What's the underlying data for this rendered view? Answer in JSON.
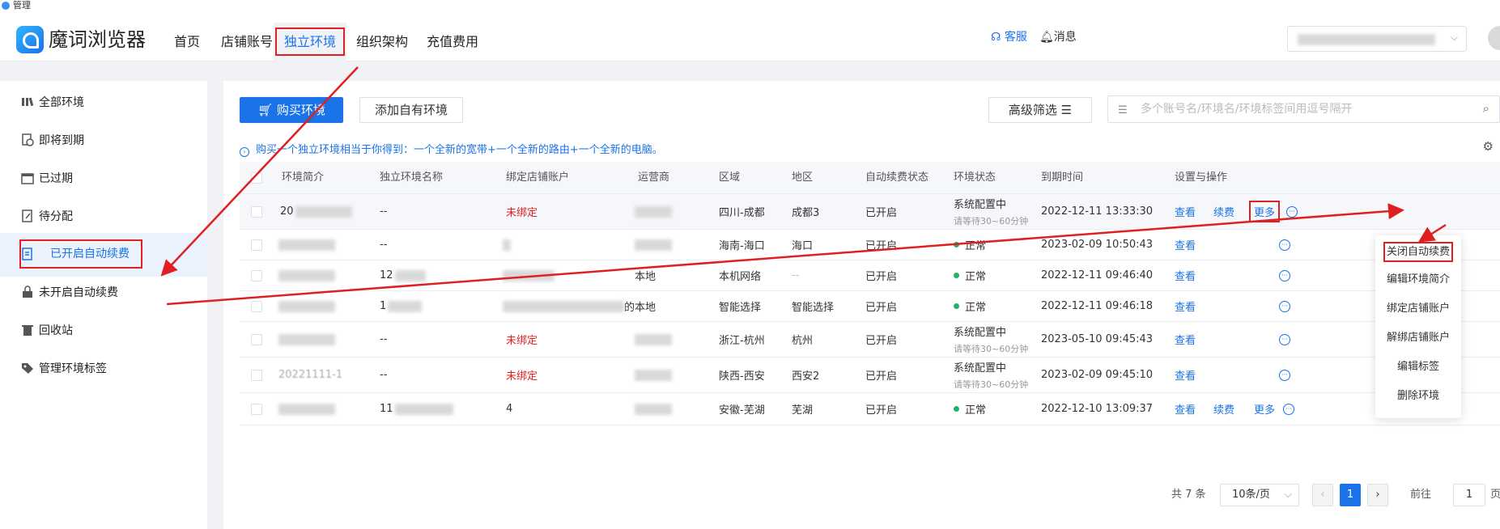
{
  "window": {
    "title": "管理"
  },
  "brand": {
    "name": "魔词浏览器"
  },
  "nav": {
    "tabs": [
      {
        "label": "首页"
      },
      {
        "label": "店铺账号"
      },
      {
        "label": "独立环境"
      },
      {
        "label": "组织架构"
      },
      {
        "label": "充值费用"
      }
    ],
    "service": "客服",
    "messages": "消息"
  },
  "sidebar": {
    "items": [
      {
        "label": "全部环境",
        "icon": "bars-icon"
      },
      {
        "label": "即将到期",
        "icon": "clock-doc-icon"
      },
      {
        "label": "已过期",
        "icon": "calendar-icon"
      },
      {
        "label": "待分配",
        "icon": "edit-doc-icon"
      },
      {
        "label": "已开启自动续费",
        "icon": "renew-doc-icon"
      },
      {
        "label": "未开启自动续费",
        "icon": "lock-icon"
      },
      {
        "label": "回收站",
        "icon": "trash-icon"
      },
      {
        "label": "管理环境标签",
        "icon": "tag-icon"
      }
    ]
  },
  "toolbar": {
    "buy_label": "购买环境",
    "add_label": "添加自有环境",
    "filter_label": "高级筛选",
    "search_placeholder": "多个账号名/环境名/环境标签间用逗号隔开"
  },
  "notice": "购买一个独立环境相当于你得到：一个全新的宽带+一个全新的路由+一个全新的电脑。",
  "table": {
    "columns": [
      "环境简介",
      "独立环境名称",
      "绑定店铺账户",
      "运营商",
      "区域",
      "地区",
      "自动续费状态",
      "环境状态",
      "到期时间",
      "设置与操作"
    ],
    "rows": [
      {
        "intro": "20",
        "name": "--",
        "account": "未绑定",
        "isp": "",
        "region": "四川-成都",
        "area": "成都3",
        "auto": "已开启",
        "status": "系统配置中",
        "status_sub": "请等待30~60分钟",
        "expire": "2022-12-11 13:33:30"
      },
      {
        "intro": "",
        "name": "--",
        "account": "",
        "isp": "",
        "region": "海南-海口",
        "area": "海口",
        "auto": "已开启",
        "status": "正常",
        "status_sub": "",
        "expire": "2023-02-09 10:50:43"
      },
      {
        "intro": "",
        "name": "12",
        "account": "",
        "isp": "本地",
        "region": "本机网络",
        "area": "--",
        "auto": "已开启",
        "status": "正常",
        "status_sub": "",
        "expire": "2022-12-11 09:46:40"
      },
      {
        "intro": "",
        "name": "1",
        "account": "的",
        "isp": "本地",
        "region": "智能选择",
        "area": "智能选择",
        "auto": "已开启",
        "status": "正常",
        "status_sub": "",
        "expire": "2022-12-11 09:46:18"
      },
      {
        "intro": "",
        "name": "--",
        "account": "未绑定",
        "isp": "",
        "region": "浙江-杭州",
        "area": "杭州",
        "auto": "已开启",
        "status": "系统配置中",
        "status_sub": "请等待30~60分钟",
        "expire": "2023-05-10 09:45:43"
      },
      {
        "intro": "20221111-1",
        "name": "--",
        "account": "未绑定",
        "isp": "",
        "region": "陕西-西安",
        "area": "西安2",
        "auto": "已开启",
        "status": "系统配置中",
        "status_sub": "请等待30~60分钟",
        "expire": "2023-02-09 09:45:10"
      },
      {
        "intro": "",
        "name": "11",
        "account": "4",
        "isp": "",
        "region": "安徽-芜湖",
        "area": "芜湖",
        "auto": "已开启",
        "status": "正常",
        "status_sub": "",
        "expire": "2022-12-10 13:09:37"
      }
    ],
    "actions": {
      "view": "查看",
      "renew": "续费",
      "more": "更多"
    }
  },
  "dropdown": {
    "items": [
      "关闭自动续费",
      "编辑环境简介",
      "绑定店铺账户",
      "解绑店铺账户",
      "编辑标签",
      "删除环境"
    ]
  },
  "pagination": {
    "total": "共 7 条",
    "page_size": "10条/页",
    "current": "1",
    "goto_label": "前往",
    "goto_value": "1",
    "page_suffix": "页"
  },
  "colors": {
    "primary": "#1a73e8",
    "annotation": "#e02020",
    "ok": "#21b26b"
  }
}
